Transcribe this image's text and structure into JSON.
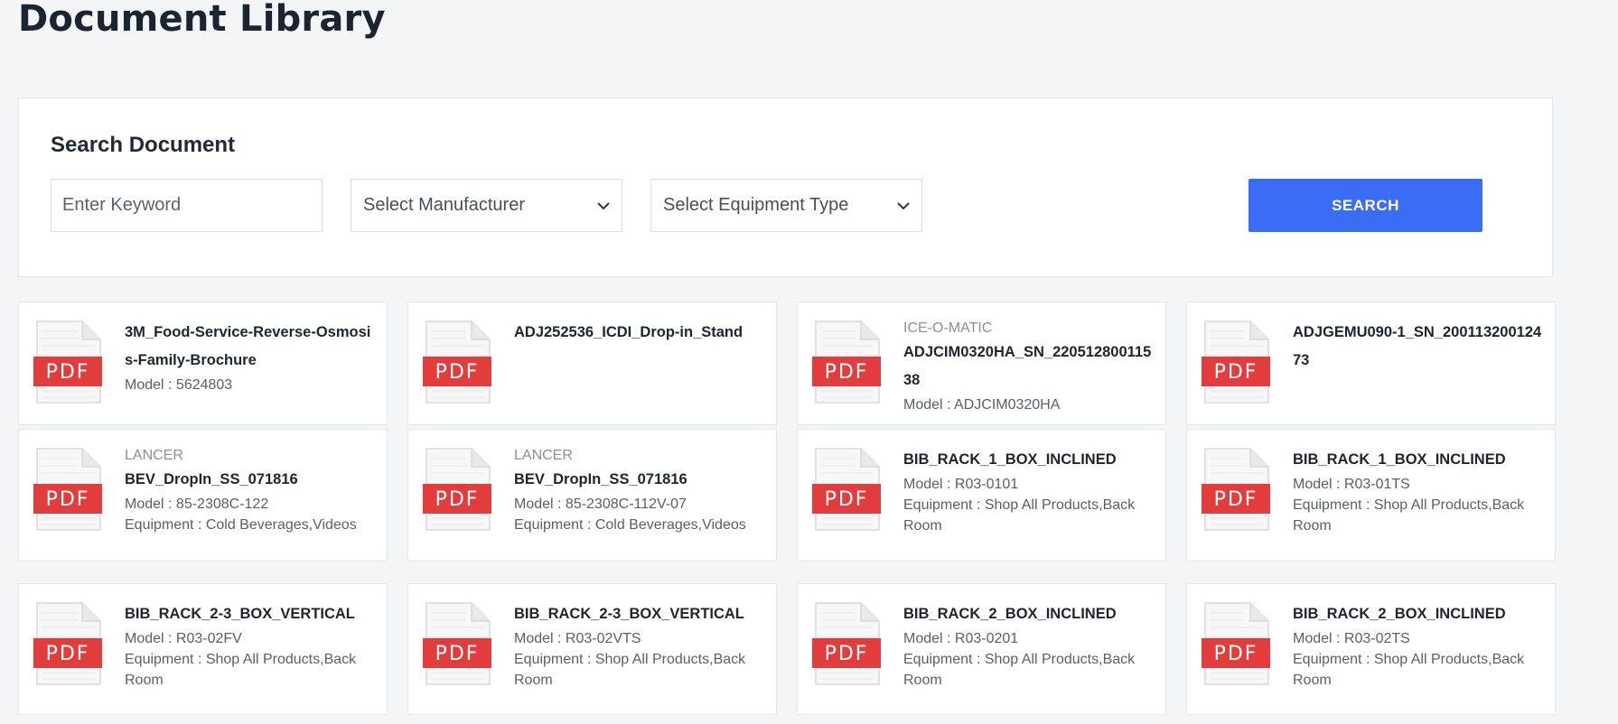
{
  "page": {
    "title": "Document Library"
  },
  "search": {
    "heading": "Search Document",
    "keyword_placeholder": "Enter Keyword",
    "manufacturer_select": "Select Manufacturer",
    "equipment_select": "Select Equipment Type",
    "button_label": "SEARCH"
  },
  "colors": {
    "accent": "#3b6cf6",
    "pdf_red": "#e23c3c",
    "background": "#f4f5f7"
  },
  "icons": {
    "file": "pdf-file-icon",
    "dropdown": "chevron-down-icon"
  },
  "documents": [
    {
      "manufacturer": "",
      "name": "3M_Food-Service-Reverse-Osmosis-Family-Brochure",
      "model": "Model : 5624803",
      "equipment": ""
    },
    {
      "manufacturer": "",
      "name": "ADJ252536_ICDI_Drop-in_Stand",
      "model": "",
      "equipment": ""
    },
    {
      "manufacturer": "ICE-O-MATIC",
      "name": "ADJCIM0320HA_SN_22051280011538",
      "model": "Model : ADJCIM0320HA",
      "equipment": ""
    },
    {
      "manufacturer": "",
      "name": "ADJGEMU090-1_SN_20011320012473",
      "model": "",
      "equipment": ""
    },
    {
      "manufacturer": "LANCER",
      "name": "BEV_DropIn_SS_071816",
      "model": "Model : 85-2308C-122",
      "equipment": "Equipment : Cold Beverages,Videos"
    },
    {
      "manufacturer": "LANCER",
      "name": "BEV_DropIn_SS_071816",
      "model": "Model : 85-2308C-112V-07",
      "equipment": "Equipment : Cold Beverages,Videos"
    },
    {
      "manufacturer": "",
      "name": "BIB_RACK_1_BOX_INCLINED",
      "model": "Model : R03-0101",
      "equipment": "Equipment : Shop All Products,Back Room"
    },
    {
      "manufacturer": "",
      "name": "BIB_RACK_1_BOX_INCLINED",
      "model": "Model : R03-01TS",
      "equipment": "Equipment : Shop All Products,Back Room"
    },
    {
      "manufacturer": "",
      "name": "BIB_RACK_2-3_BOX_VERTICAL",
      "model": "Model : R03-02FV",
      "equipment": "Equipment : Shop All Products,Back Room"
    },
    {
      "manufacturer": "",
      "name": "BIB_RACK_2-3_BOX_VERTICAL",
      "model": "Model : R03-02VTS",
      "equipment": "Equipment : Shop All Products,Back Room"
    },
    {
      "manufacturer": "",
      "name": "BIB_RACK_2_BOX_INCLINED",
      "model": "Model : R03-0201",
      "equipment": "Equipment : Shop All Products,Back Room"
    },
    {
      "manufacturer": "",
      "name": "BIB_RACK_2_BOX_INCLINED",
      "model": "Model : R03-02TS",
      "equipment": "Equipment : Shop All Products,Back Room"
    }
  ]
}
